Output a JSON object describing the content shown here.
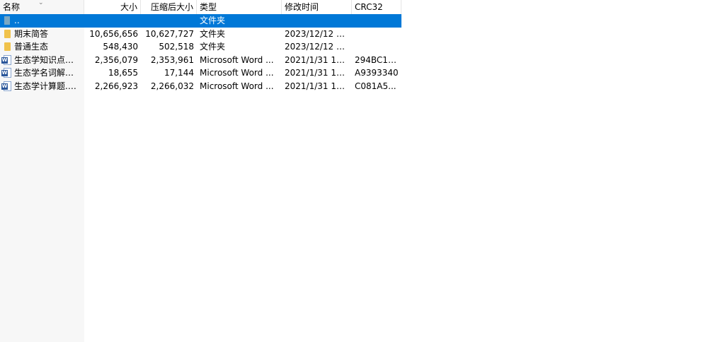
{
  "columns": {
    "name": "名称",
    "size": "大小",
    "packed": "压缩后大小",
    "type": "类型",
    "mtime": "修改时间",
    "crc": "CRC32"
  },
  "rows": [
    {
      "name": "..",
      "size": "",
      "packed": "",
      "type": "文件夹",
      "mtime": "",
      "crc": "",
      "icon": "up-folder-icon"
    },
    {
      "name": "期末简答",
      "size": "10,656,656",
      "packed": "10,627,727",
      "type": "文件夹",
      "mtime": "2023/12/12 2...",
      "crc": "",
      "icon": "folder-icon"
    },
    {
      "name": "普通生态",
      "size": "548,430",
      "packed": "502,518",
      "type": "文件夹",
      "mtime": "2023/12/12 2...",
      "crc": "",
      "icon": "folder-icon"
    },
    {
      "name": "生态学知识点总...",
      "size": "2,356,079",
      "packed": "2,353,961",
      "type": "Microsoft Word ...",
      "mtime": "2021/1/31 11:...",
      "crc": "294BC1A...",
      "icon": "word-document-icon"
    },
    {
      "name": "生态学名词解释(...",
      "size": "18,655",
      "packed": "17,144",
      "type": "Microsoft Word ...",
      "mtime": "2021/1/31 11:...",
      "crc": "A9393340",
      "icon": "word-document-icon"
    },
    {
      "name": "生态学计算题.do...",
      "size": "2,266,923",
      "packed": "2,266,032",
      "type": "Microsoft Word ...",
      "mtime": "2021/1/31 11:...",
      "crc": "C081A5...",
      "icon": "word-document-icon"
    }
  ],
  "colors": {
    "selection": "#0078d7",
    "folder": "#f0c24b",
    "word": "#2b579a"
  }
}
